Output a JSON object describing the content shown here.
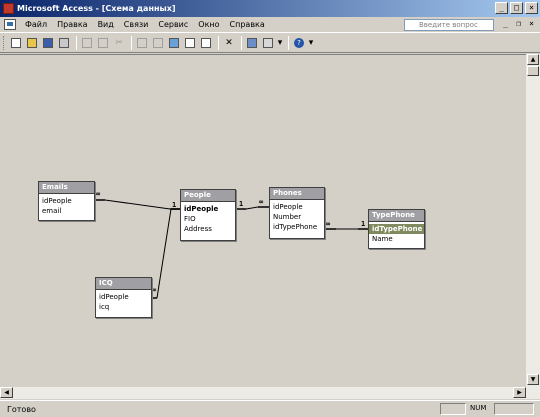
{
  "window": {
    "title": "Microsoft Access - [Схема данных]",
    "minimize": "_",
    "maximize": "□",
    "close": "×"
  },
  "menu": {
    "items": [
      "Файл",
      "Правка",
      "Вид",
      "Связи",
      "Сервис",
      "Окно",
      "Справка"
    ],
    "help_placeholder": "Введите вопрос",
    "doc_minimize": "_",
    "doc_restore": "❐",
    "doc_close": "×"
  },
  "toolbar": {
    "icons": [
      "new-icon",
      "open-icon",
      "save-icon",
      "print-icon",
      "print-preview-icon",
      "spell-icon",
      "cut-icon",
      "copy-icon",
      "paste-icon",
      "show-table-icon",
      "direct-relationships-icon",
      "all-relationships-icon",
      "delete-icon",
      "database-window-icon",
      "new-object-icon",
      "help-icon"
    ]
  },
  "tables": {
    "emails": {
      "name": "Emails",
      "fields": [
        "idPeople",
        "email"
      ]
    },
    "people": {
      "name": "People",
      "fields": [
        "idPeople",
        "FIO",
        "Address"
      ]
    },
    "phones": {
      "name": "Phones",
      "fields": [
        "idPeople",
        "Number",
        "idTypePhone"
      ]
    },
    "typephone": {
      "name": "TypePhone",
      "fields": [
        "idTypePhone",
        "Name"
      ]
    },
    "icq": {
      "name": "ICQ",
      "fields": [
        "idPeople",
        "icq"
      ]
    }
  },
  "relationships": [
    {
      "from": "People.idPeople",
      "to": "Emails.idPeople",
      "one": "1",
      "many": "∞"
    },
    {
      "from": "People.idPeople",
      "to": "Phones.idPeople",
      "one": "1",
      "many": "∞"
    },
    {
      "from": "People.idPeople",
      "to": "ICQ.idPeople",
      "one": "1",
      "many": "∞"
    },
    {
      "from": "TypePhone.idTypePhone",
      "to": "Phones.idTypePhone",
      "one": "1",
      "many": "∞"
    }
  ],
  "status": {
    "text": "Готово",
    "num": "NUM"
  }
}
